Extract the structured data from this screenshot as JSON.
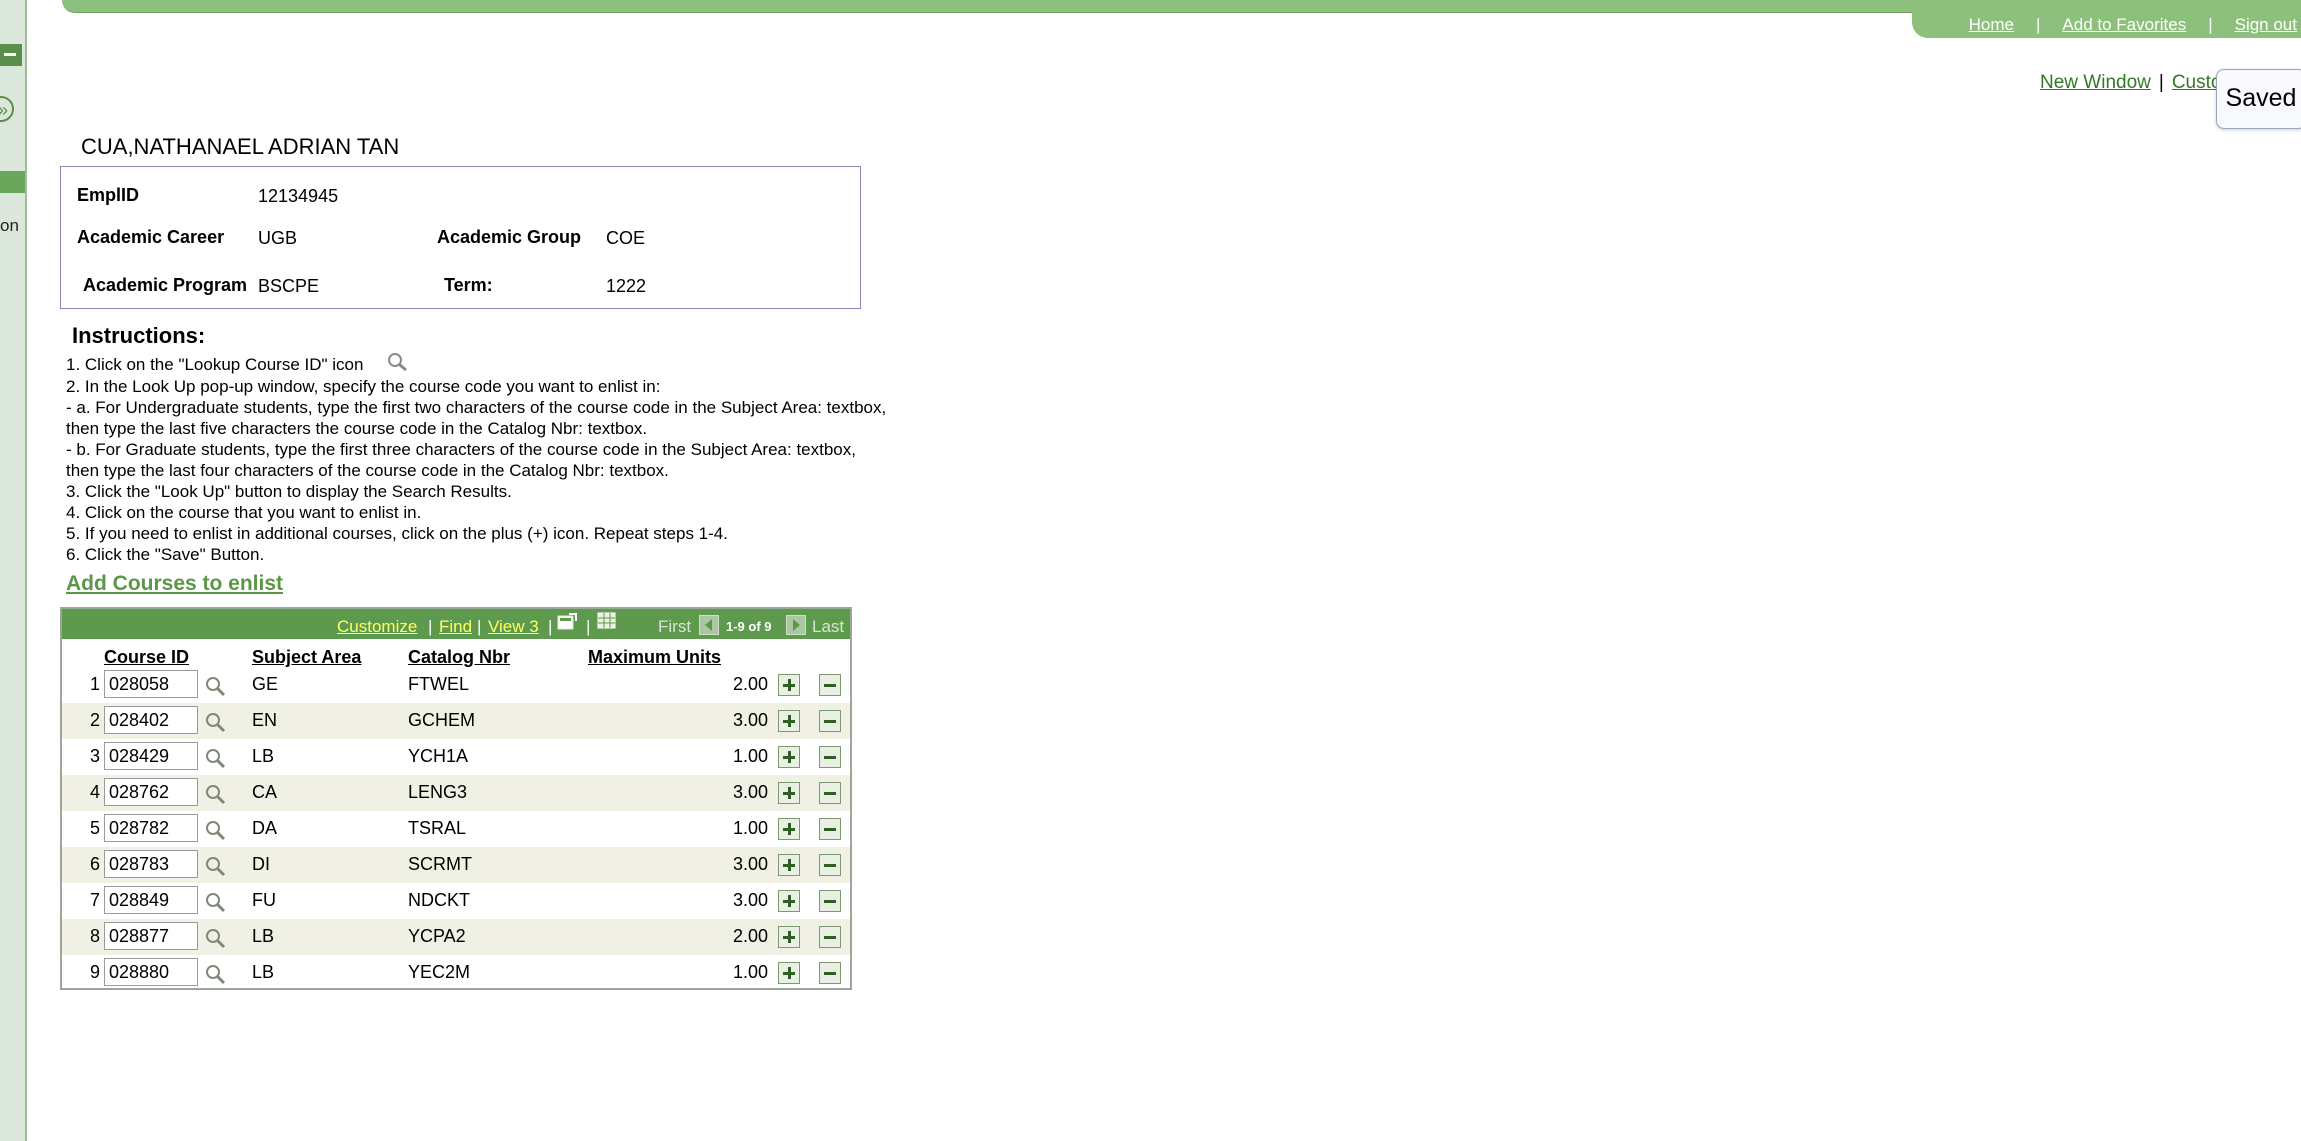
{
  "header": {
    "links": [
      "Home",
      "Add to Favorites",
      "Sign out"
    ]
  },
  "sub_links": {
    "new_window": "New Window",
    "customize": "Custo"
  },
  "saved_button": "Saved",
  "left_panel": {
    "partial_text": "on"
  },
  "student": {
    "name": "CUA,NATHANAEL ADRIAN TAN",
    "emplid_label": "EmplID",
    "emplid": "12134945",
    "career_label": "Academic Career",
    "career": "UGB",
    "group_label": "Academic Group",
    "group": "COE",
    "program_label": "Academic Program",
    "program": "BSCPE",
    "term_label": "Term:",
    "term": "1222"
  },
  "instructions": {
    "title": "Instructions:",
    "lines": [
      "1. Click on the \"Lookup Course ID\" icon",
      "2. In the Look Up pop-up window, specify the course code you want to enlist in:",
      "- a. For Undergraduate students, type the first two characters of the course code in the Subject Area: textbox,",
      "then type the last five characters the course code in the Catalog Nbr: textbox.",
      "- b. For Graduate students, type the first three characters of the course code in the Subject Area: textbox,",
      "then type the last four characters of the course code in the Catalog Nbr: textbox.",
      "3. Click the \"Look Up\" button to display the Search Results.",
      "4. Click on the course that you want to enlist in.",
      "5. If you need to enlist in additional courses, click on the plus (+) icon. Repeat steps 1-4.",
      "6. Click the \"Save\" Button."
    ]
  },
  "add_courses_title": "Add Courses to enlist",
  "grid": {
    "nav": {
      "customize": "Customize",
      "find": "Find",
      "view": "View 3",
      "first": "First",
      "range": "1-9 of 9",
      "last": "Last"
    },
    "headers": [
      "Course ID",
      "Subject Area",
      "Catalog Nbr",
      "Maximum Units"
    ],
    "rows": [
      {
        "n": "1",
        "course_id": "028058",
        "subject": "GE",
        "catalog": "FTWEL",
        "units": "2.00"
      },
      {
        "n": "2",
        "course_id": "028402",
        "subject": "EN",
        "catalog": "GCHEM",
        "units": "3.00"
      },
      {
        "n": "3",
        "course_id": "028429",
        "subject": "LB",
        "catalog": "YCH1A",
        "units": "1.00"
      },
      {
        "n": "4",
        "course_id": "028762",
        "subject": "CA",
        "catalog": "LENG3",
        "units": "3.00"
      },
      {
        "n": "5",
        "course_id": "028782",
        "subject": "DA",
        "catalog": "TSRAL",
        "units": "1.00"
      },
      {
        "n": "6",
        "course_id": "028783",
        "subject": "DI",
        "catalog": "SCRMT",
        "units": "3.00"
      },
      {
        "n": "7",
        "course_id": "028849",
        "subject": "FU",
        "catalog": "NDCKT",
        "units": "3.00"
      },
      {
        "n": "8",
        "course_id": "028877",
        "subject": "LB",
        "catalog": "YCPA2",
        "units": "2.00"
      },
      {
        "n": "9",
        "course_id": "028880",
        "subject": "LB",
        "catalog": "YEC2M",
        "units": "1.00"
      }
    ]
  },
  "colors": {
    "accent": "#5e9a4d",
    "header_bar": "#8cc07c",
    "link": "#2f7a22"
  }
}
